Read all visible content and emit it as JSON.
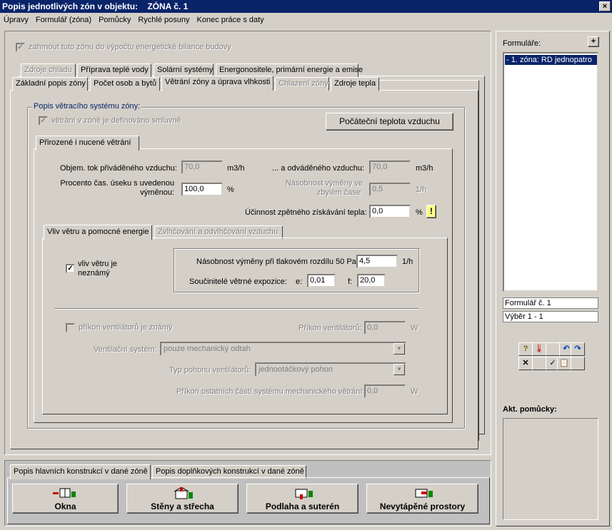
{
  "window": {
    "title": "Popis jednotlivých zón v objektu:    ZÓNA č. 1",
    "close": "×"
  },
  "menu": [
    "Úpravy",
    "Formulář (zóna)",
    "Pomůcky",
    "Rychlé posuny",
    "Konec práce s daty"
  ],
  "top_checkbox": {
    "label": "zahrnout tuto zónu do výpočtu energetické bilance budovy",
    "check": "✓"
  },
  "tabs_row1": [
    {
      "label": "Zdroje chladu"
    },
    {
      "label": "Příprava teplé vody"
    },
    {
      "label": "Solární systémy"
    },
    {
      "label": "Energonositele, primární energie a emise"
    }
  ],
  "tabs_row2": [
    {
      "label": "Základní popis zóny"
    },
    {
      "label": "Počet osob a bytů"
    },
    {
      "label": "Větrání zóny a úprava vlhkosti"
    },
    {
      "label": "Chlazení zóny"
    },
    {
      "label": "Zdroje tepla"
    }
  ],
  "vent": {
    "group_title": "Popis větracího systému zóny:",
    "contract_label": "větrání v zóně je definováno smluvně",
    "contract_check": "✓",
    "initial_temp_button": "Počáteční teplota vzduchu",
    "inner_tab": "Přirozené i nucené větrání",
    "supply_label": "Objem. tok přiváděného vzduchu:",
    "supply_value": "70,0",
    "supply_unit": "m3/h",
    "exhaust_label": "... a odváděného vzduchu:",
    "exhaust_value": "70,0",
    "exhaust_unit": "m3/h",
    "percent_label_1": "Procento čas. úseku s uvedenou",
    "percent_label_2": "výměnou:",
    "percent_value": "100,0",
    "percent_unit": "%",
    "rest_label_1": "Násobnost výměny ve",
    "rest_label_2": "zbylém čase:",
    "rest_value": "0,5",
    "rest_unit": "1/h",
    "recovery_label": "Účinnost zpětného získávání tepla:",
    "recovery_value": "0,0",
    "recovery_unit": "%",
    "recovery_btn": "!",
    "subtabs": [
      {
        "label": "Vliv větru a pomocné energie"
      },
      {
        "label": "Zvlhčování a odvlhčování vzduchu"
      }
    ],
    "wind_unknown_label_1": "vliv větru je",
    "wind_unknown_label_2": "neznámý",
    "wind_check": "✓",
    "n50_label": "Násobnost výměny při tlakovém rozdílu 50 Pa:",
    "n50_value": "4,5",
    "n50_unit": "1/h",
    "exposure_label": "Součinitelé větrné expozice:",
    "e_label": "e:",
    "e_value": "0,01",
    "f_label": "f:",
    "f_value": "20,0",
    "fan_known_label": "příkon ventilátorů je známý",
    "fan_power_label": "Příkon ventilátorů:",
    "fan_power_value": "0,0",
    "fan_power_unit": "W",
    "system_label": "Ventilační systém:",
    "system_value": "pouze mechanický odtah",
    "drive_label": "Typ pohonu ventilátorů:",
    "drive_value": "jednootáčkový pohon",
    "other_label": "Příkon ostatních částí systému mechanického větrání:",
    "other_value": "0,0",
    "other_unit": "W"
  },
  "bottom": {
    "tabs": [
      {
        "label": "Popis hlavních konstrukcí v dané zóně"
      },
      {
        "label": "Popis doplňkových konstrukcí v dané zóně"
      }
    ],
    "buttons": [
      {
        "label": "Okna"
      },
      {
        "label": "Stěny a střecha"
      },
      {
        "label": "Podlaha a suterén"
      },
      {
        "label": "Nevytápěné prostory"
      }
    ]
  },
  "right": {
    "forms_label": "Formuláře:",
    "plus": "+",
    "tree_item": "- 1. zóna: RD jednopatro",
    "form_no": "Formulář č.  1",
    "selection": "Výběr  1 - 1",
    "tools": [
      "?",
      "🌡",
      "",
      "↶",
      "↷",
      "✕",
      "",
      "✓",
      "📋",
      ""
    ],
    "aids_label": "Akt. pomůcky:"
  },
  "colors": {
    "title_bg": "#0a246a",
    "face": "#d4d0c8",
    "accent": "#0a246a"
  }
}
